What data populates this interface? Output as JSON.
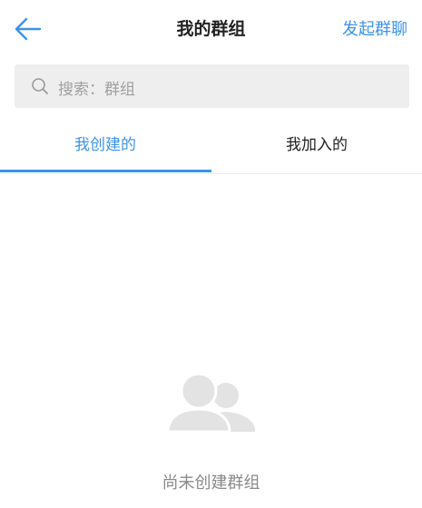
{
  "header": {
    "back_icon": "arrow-left-icon",
    "title": "我的群组",
    "action_label": "发起群聊"
  },
  "search": {
    "icon": "search-icon",
    "placeholder": "搜索：群组"
  },
  "tabs": [
    {
      "label": "我创建的",
      "active": true
    },
    {
      "label": "我加入的",
      "active": false
    }
  ],
  "empty_state": {
    "icon": "group-users-icon",
    "message": "尚未创建群组"
  },
  "colors": {
    "accent": "#3d93e8",
    "text": "#222222",
    "muted": "#8a8a8a",
    "search_bg": "#eeeeee",
    "empty_icon": "#e3e3e3"
  }
}
